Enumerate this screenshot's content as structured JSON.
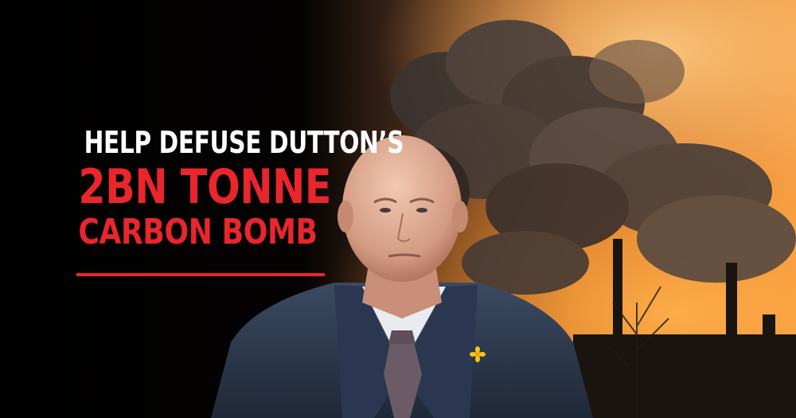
{
  "headline": {
    "line1": "HELP DEFUSE DUTTON’S",
    "line2": "2BN TONNE",
    "line3": "CARBON BOMB"
  },
  "colors": {
    "background": "#000000",
    "headline_white": "#ffffff",
    "headline_red": "#e8262c",
    "smoke_orange": "#f0913a"
  }
}
